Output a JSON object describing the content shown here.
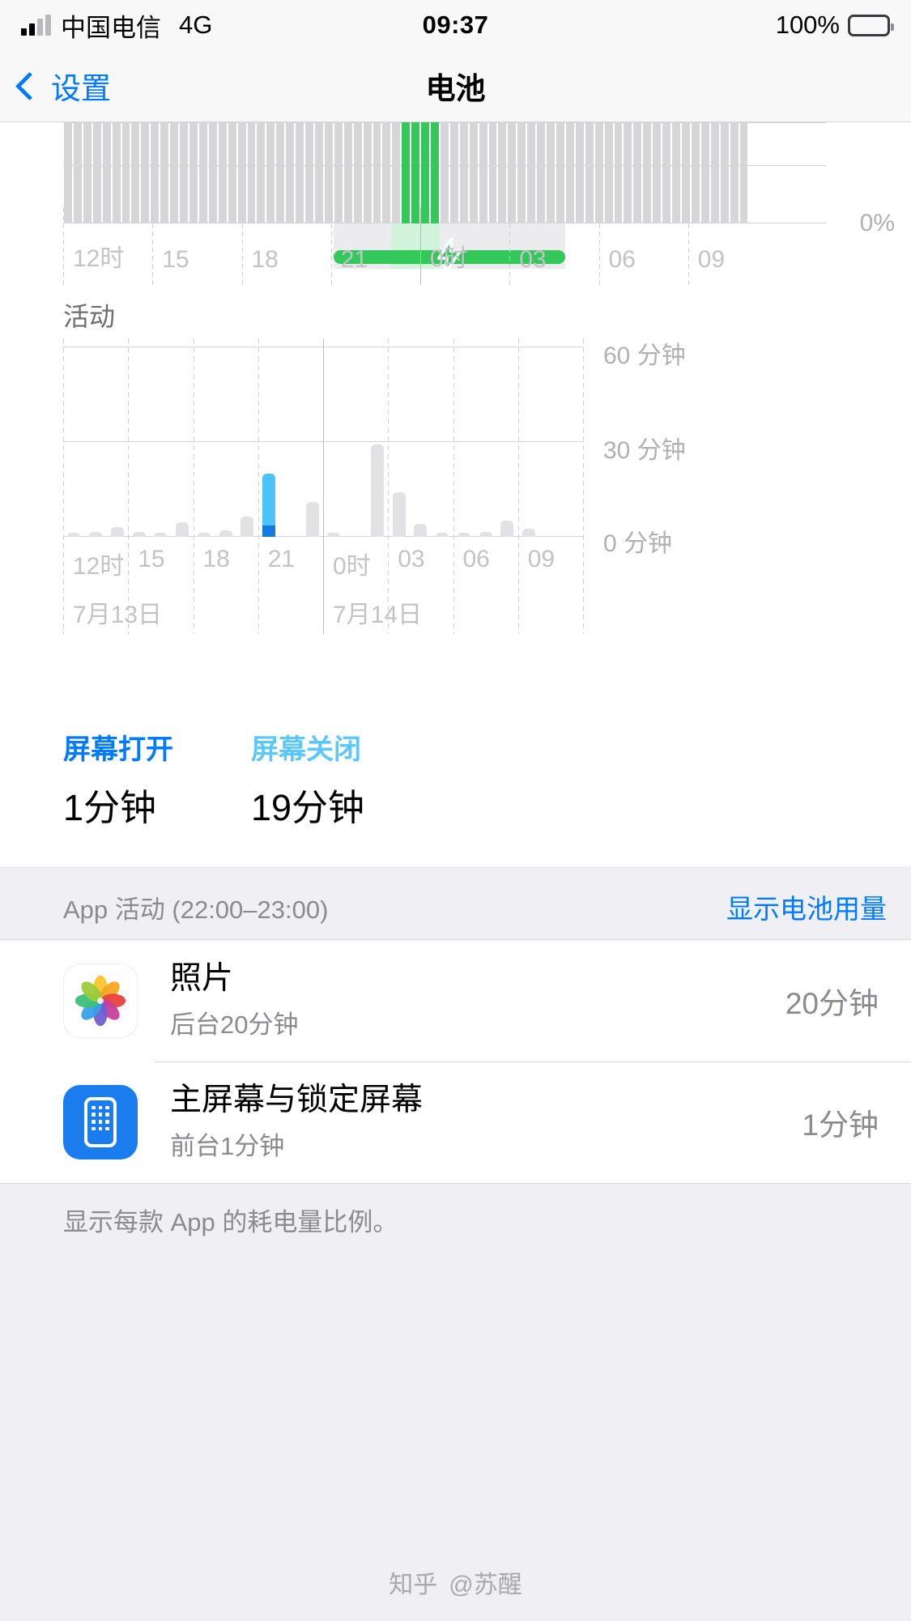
{
  "status_bar": {
    "carrier": "中国电信",
    "network": "4G",
    "time": "09:37",
    "battery_percent": "100%",
    "signal_icon": "signal-bars-icon",
    "battery_icon": "battery-full-icon"
  },
  "nav_bar": {
    "back_label": "设置",
    "back_icon": "chevron-left-icon",
    "title": "电池"
  },
  "activity_section": {
    "title": "活动"
  },
  "screen_usage": {
    "on_label": "屏幕打开",
    "on_value": "1分钟",
    "off_label": "屏幕关闭",
    "off_value": "19分钟"
  },
  "app_activity": {
    "header": "App 活动 (22:00–23:00)",
    "link": "显示电池用量",
    "rows": [
      {
        "icon": "photos-app-icon",
        "name": "照片",
        "subtitle": "后台20分钟",
        "time": "20分钟"
      },
      {
        "icon": "home-and-lock-screen-icon",
        "name": "主屏幕与锁定屏幕",
        "subtitle": "前台1分钟",
        "time": "1分钟"
      }
    ],
    "footnote": "显示每款 App 的耗电量比例。"
  },
  "watermark": {
    "logo": "知乎",
    "user": "@苏醒"
  },
  "colors": {
    "accent_blue": "#007aff",
    "light_blue": "#5ac8fa",
    "bar_blue": "#4cc4f7",
    "bar_blue_dark": "#1479e0",
    "green": "#34c759",
    "grey_bar": "#e2e2e4",
    "grey_text": "#8a8a8f",
    "bg": "#efeff4"
  },
  "chart_data": [
    {
      "type": "bar",
      "name": "battery-level-chart",
      "title": "",
      "note": "clipped top chart — battery level over 24h, charging session highlighted",
      "categories": [
        "12时",
        "15",
        "18",
        "21",
        "0时",
        "03",
        "06",
        "09"
      ],
      "xtick_positions": [
        0,
        12.5,
        25,
        37.5,
        50,
        62.5,
        75,
        87.5
      ],
      "ytick_labels": [
        "0%"
      ],
      "ylabel": "",
      "xlabel": "",
      "grid": true,
      "values": [
        100,
        100,
        100,
        100,
        100,
        100,
        100,
        100,
        100,
        100,
        100,
        100,
        100,
        100,
        100,
        100,
        100,
        100,
        100,
        100,
        100,
        100,
        100,
        100,
        100,
        100,
        100,
        100,
        100,
        100,
        100,
        100,
        100,
        100,
        100,
        100,
        100,
        100,
        100,
        100,
        100,
        100,
        100,
        100,
        100,
        100,
        100,
        100,
        100,
        100,
        100,
        100,
        100,
        100,
        100,
        100,
        100,
        100,
        100,
        100,
        100,
        100,
        100,
        100,
        100,
        100,
        100,
        100,
        100,
        100,
        100,
        0,
        0,
        0
      ],
      "green_indices": [
        35,
        36,
        37,
        38
      ],
      "charge_band": {
        "start_index": 28,
        "end_index": 52,
        "label_icon": "lightning-bolt-icon"
      }
    },
    {
      "type": "bar",
      "name": "activity-chart",
      "title": "活动",
      "categories": [
        "12时",
        "15",
        "18",
        "21",
        "0时",
        "03",
        "06",
        "09"
      ],
      "dates": [
        "7月13日",
        "7月14日"
      ],
      "ytick_labels": [
        "60 分钟",
        "30 分钟",
        "0 分钟"
      ],
      "ylim": [
        0,
        60
      ],
      "ylabel": "分钟",
      "xlabel": "",
      "grid": true,
      "series": [
        {
          "name": "屏幕关闭",
          "color": "#e2e2e4",
          "values": [
            1,
            1.5,
            3,
            1.5,
            0.5,
            4.5,
            0.5,
            2,
            6.5,
            4,
            0,
            11,
            0.5,
            0,
            29,
            14,
            4,
            0.5,
            1,
            1.5,
            5,
            2.5,
            0,
            0
          ]
        },
        {
          "name": "屏幕打开",
          "color": "#4cc4f7",
          "values": [
            0,
            0,
            0,
            0,
            0,
            0,
            0,
            0,
            0,
            20,
            0,
            0,
            0,
            0,
            0,
            0,
            0,
            0,
            0,
            0,
            0,
            0,
            0,
            0
          ]
        }
      ],
      "highlight_index": 9,
      "highlight_base_color": "#1479e0"
    }
  ]
}
